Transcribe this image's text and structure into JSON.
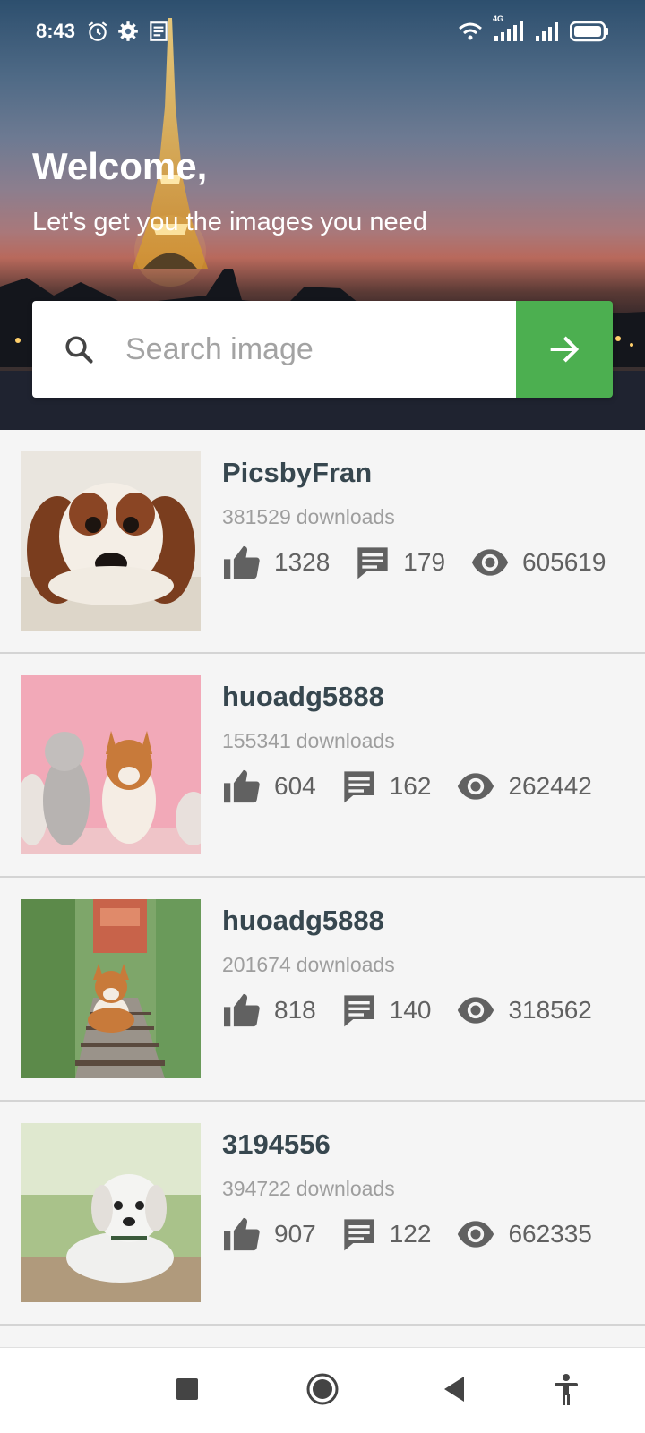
{
  "status_bar": {
    "time": "8:43",
    "network_label": "4G",
    "icons": [
      "alarm-icon",
      "settings-icon",
      "notes-icon",
      "wifi-icon",
      "signal-icon",
      "battery-icon"
    ]
  },
  "header": {
    "welcome": "Welcome,",
    "subtitle": "Let's get you the images you need"
  },
  "search": {
    "placeholder": "Search image",
    "value": "",
    "submit_icon": "arrow-right-icon",
    "accent_color": "#4caf50"
  },
  "results": [
    {
      "user": "PicsbyFran",
      "downloads": "381529",
      "downloads_label": "downloads",
      "likes": "1328",
      "comments": "179",
      "views": "605619",
      "image": "spaniel-puppy"
    },
    {
      "user": "huoadg5888",
      "downloads": "155341",
      "downloads_label": "downloads",
      "likes": "604",
      "comments": "162",
      "views": "262442",
      "image": "poodles-and-corgi-on-pink"
    },
    {
      "user": "huoadg5888",
      "downloads": "201674",
      "downloads_label": "downloads",
      "likes": "818",
      "comments": "140",
      "views": "318562",
      "image": "corgi-on-rail-tracks"
    },
    {
      "user": "3194556",
      "downloads": "394722",
      "downloads_label": "downloads",
      "likes": "907",
      "comments": "122",
      "views": "662335",
      "image": "white-puppy-on-wood"
    }
  ],
  "nav_bar": {
    "buttons": [
      "recents-button",
      "home-button",
      "back-button",
      "accessibility-button"
    ]
  }
}
